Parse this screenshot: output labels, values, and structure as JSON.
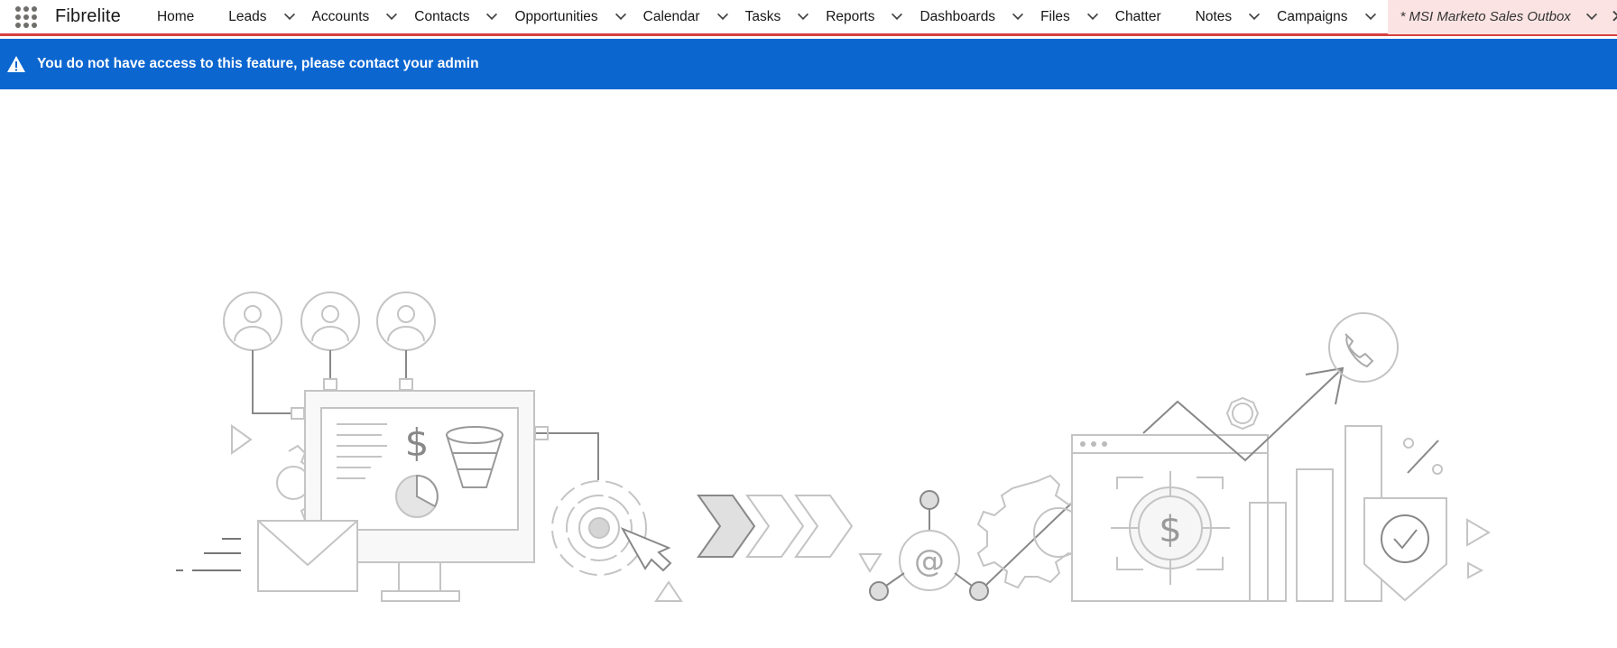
{
  "app": {
    "name": "Fibrelite"
  },
  "nav": {
    "items": [
      {
        "label": "Home",
        "has_menu": false
      },
      {
        "label": "Leads",
        "has_menu": true
      },
      {
        "label": "Accounts",
        "has_menu": true
      },
      {
        "label": "Contacts",
        "has_menu": true
      },
      {
        "label": "Opportunities",
        "has_menu": true
      },
      {
        "label": "Calendar",
        "has_menu": true
      },
      {
        "label": "Tasks",
        "has_menu": true
      },
      {
        "label": "Reports",
        "has_menu": true
      },
      {
        "label": "Dashboards",
        "has_menu": true
      },
      {
        "label": "Files",
        "has_menu": true
      },
      {
        "label": "Chatter",
        "has_menu": false
      },
      {
        "label": "Notes",
        "has_menu": true
      },
      {
        "label": "Campaigns",
        "has_menu": true
      }
    ],
    "active_tab": {
      "label": "* MSI Marketo Sales Outbox"
    }
  },
  "banner": {
    "message": "You do not have access to this feature, please contact your admin",
    "icon": "warning-icon"
  },
  "colors": {
    "banner_bg": "#0b66d0",
    "active_tab_bg": "#fbe3e3",
    "nav_accent": "#d6403f"
  }
}
